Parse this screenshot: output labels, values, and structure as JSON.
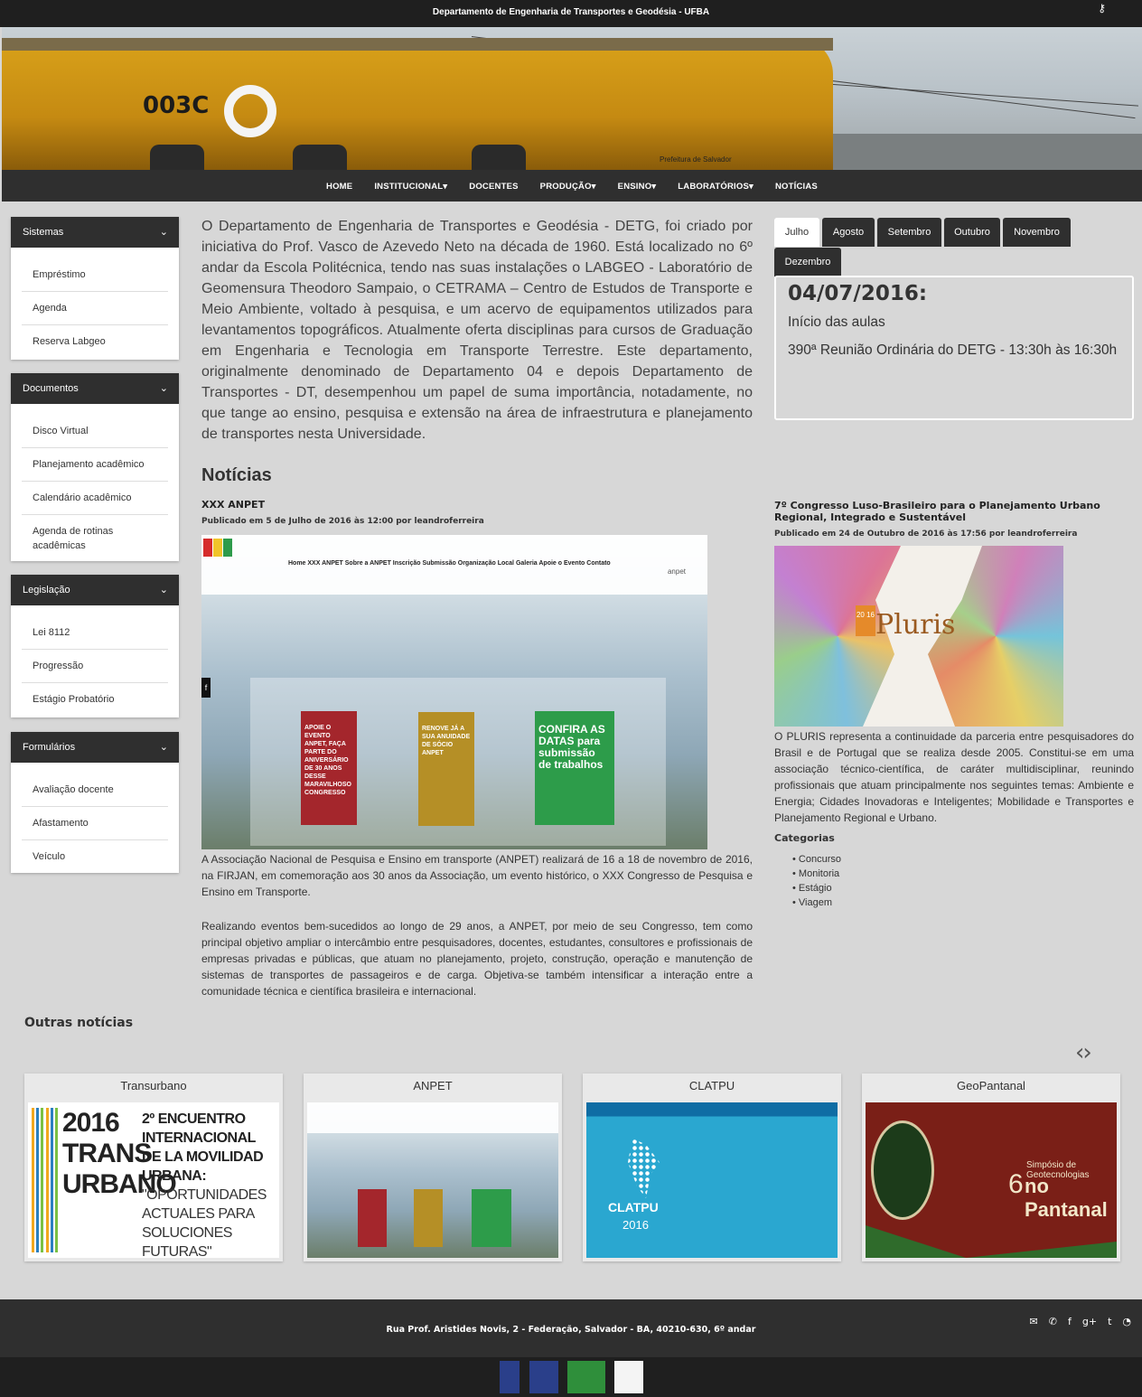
{
  "topbar": {
    "title": "Departamento de Engenharia de Transportes e Geodésia - UFBA"
  },
  "hero": {
    "train_number": "003C",
    "sign": "Prefeitura de Salvador"
  },
  "nav": {
    "items": [
      "HOME",
      "INSTITUCIONAL▾",
      "DOCENTES",
      "PRODUÇÃO▾",
      "ENSINO▾",
      "LABORATÓRIOS▾",
      "NOTÍCIAS"
    ]
  },
  "sidebar": {
    "sistemas": {
      "title": "Sistemas",
      "items": [
        "Empréstimo",
        "Agenda",
        "Reserva Labgeo"
      ]
    },
    "documentos": {
      "title": "Documentos",
      "items": [
        "Disco Virtual",
        "Planejamento acadêmico",
        "Calendário acadêmico",
        "Agenda de rotinas acadêmicas"
      ]
    },
    "legislacao": {
      "title": "Legislação",
      "items": [
        "Lei 8112",
        "Progressão",
        "Estágio Probatório"
      ]
    },
    "formularios": {
      "title": "Formulários",
      "items": [
        "Avaliação docente",
        "Afastamento",
        "Veículo"
      ]
    }
  },
  "intro": "O Departamento de Engenharia de Transportes e Geodésia - DETG, foi criado por iniciativa do Prof. Vasco de Azevedo Neto na década de 1960. Está localizado no 6º andar da Escola Politécnica, tendo nas suas instalações o LABGEO - Laboratório de Geomensura Theodoro Sampaio, o CETRAMA – Centro de Estudos de Transporte e Meio Ambiente, voltado à pesquisa, e um acervo de equipamentos utilizados para levantamentos topográficos. Atualmente oferta disciplinas para cursos de Graduação em Engenharia e Tecnologia em Transporte Terrestre. Este departamento, originalmente denominado de Departamento 04 e depois Departamento de Transportes - DT, desempenhou um papel de suma importância, notadamente, no que tange ao ensino, pesquisa e extensão na área de infraestrutura e planejamento de transportes nesta Universidade.",
  "calendar": {
    "tabs": [
      "Julho",
      "Agosto",
      "Setembro",
      "Outubro",
      "Novembro",
      "Dezembro"
    ],
    "active_tab": "Julho",
    "date": "04/07/2016:",
    "events": [
      "Início das aulas",
      "390ª Reunião Ordinária do DETG - 13:30h às 16:30h"
    ]
  },
  "news": {
    "heading": "Notícias",
    "post1": {
      "title": "XXX ANPET",
      "meta": "Publicado em 5 de Julho de 2016 às 12:00 por leandroferreira",
      "image": {
        "menu": "Home   XXX ANPET   Sobre a ANPET   Inscrição   Submissão   Organização   Local   Galeria   Apoie o Evento   Contato",
        "brand": "anpet",
        "card1": "APOIE O EVENTO ANPET, FAÇA PARTE DO ANIVERSÁRIO DE 30 ANOS DESSE MARAVILHOSO CONGRESSO",
        "card2": "RENOVE JÁ A SUA ANUIDADE DE SÓCIO ANPET",
        "card3": "CONFIRA AS DATAS para submissão de trabalhos"
      },
      "body1": "A Associação Nacional de Pesquisa e Ensino em transporte (ANPET) realizará de 16 a 18 de novembro de 2016, na FIRJAN, em comemoração aos 30 anos da Associação, um evento histórico, o XXX Congresso de Pesquisa e Ensino em Transporte.",
      "body2": "Realizando eventos bem-sucedidos ao longo de 29 anos, a ANPET, por meio de seu Congresso, tem como principal objetivo ampliar o intercâmbio entre pesquisadores, docentes, estudantes, consultores e profissionais de empresas privadas e públicas, que atuam no planejamento, projeto, construção, operação e manutenção de sistemas de transportes de passageiros e de carga. Objetiva-se também intensificar a interação entre a comunidade técnica e científica brasileira e internacional."
    },
    "post2": {
      "title": "7º Congresso Luso-Brasileiro para o Planejamento Urbano Regional, Integrado e Sustentável",
      "meta": "Publicado em 24 de Outubro de 2016 às 17:56 por leandroferreira",
      "image": {
        "word": "Pluris",
        "badge": "20 16"
      },
      "body": "O PLURIS representa a continuidade da parceria entre pesquisadores do Brasil e de Portugal que se realiza desde 2005. Constitui-se em uma associação técnico-científica, de caráter multidisciplinar, reunindo profissionais que atuam principalmente nos seguintes temas: Ambiente e Energia; Cidades Inovadoras e Inteligentes; Mobilidade e Transportes e Planejamento Regional e Urbano."
    },
    "categories": {
      "title": "Categorias",
      "items": [
        "Concurso",
        "Monitoria",
        "Estágio",
        "Viagem"
      ]
    }
  },
  "outras": {
    "heading": "Outras notícias",
    "arrows": "‹›",
    "cards": [
      {
        "title": "Transurbano",
        "big": "2016 TRANS URBANO",
        "text": "2º ENCUENTRO INTERNACIONAL DE LA MOVILIDAD URBANA:",
        "quote": "\"OPORTUNIDADES ACTUALES PARA SOLUCIONES FUTURAS\""
      },
      {
        "title": "ANPET"
      },
      {
        "title": "CLATPU",
        "label": "CLATPU",
        "year": "2016"
      },
      {
        "title": "GeoPantanal",
        "line1": "Simpósio de Geotecnologias",
        "line2": "no Pantanal",
        "six": "6"
      }
    ]
  },
  "footer": {
    "address": "Rua Prof. Aristides Novis, 2 - Federação, Salvador - BA, 40210-630, 6º andar",
    "icons": [
      "envelope-icon",
      "phone-icon",
      "facebook-icon",
      "google-plus-icon",
      "twitter-icon",
      "rss-icon"
    ],
    "icon_glyphs": [
      "✉",
      "✆",
      "f",
      "g+",
      "t",
      "◔"
    ]
  }
}
